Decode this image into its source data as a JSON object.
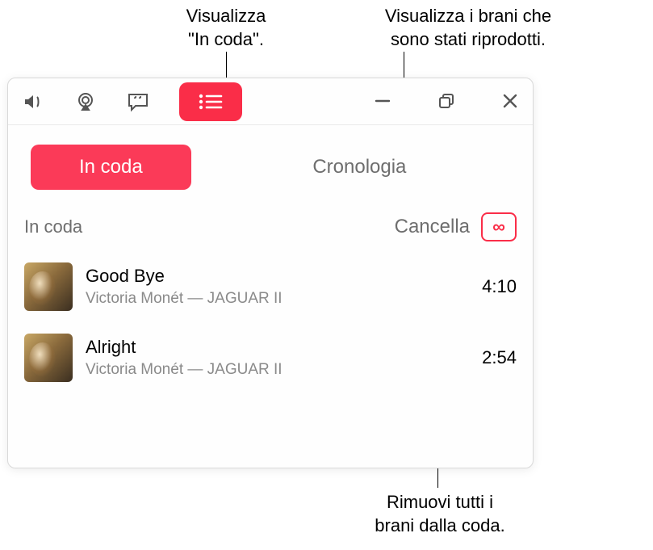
{
  "callouts": {
    "queue": "Visualizza\n\"In coda\".",
    "history": "Visualizza i brani che\nsono stati riprodotti.",
    "clear": "Rimuovi tutti i\nbrani dalla coda."
  },
  "tabs": {
    "active_label": "In coda",
    "inactive_label": "Cronologia"
  },
  "section": {
    "title": "In coda",
    "clear_label": "Cancella",
    "autoplay_symbol": "∞"
  },
  "tracks": [
    {
      "title": "Good Bye",
      "artist": "Victoria Monét",
      "album": "JAGUAR II",
      "duration": "4:10"
    },
    {
      "title": "Alright",
      "artist": "Victoria Monét",
      "album": "JAGUAR II",
      "duration": "2:54"
    }
  ],
  "colors": {
    "accent": "#fa2d48"
  }
}
